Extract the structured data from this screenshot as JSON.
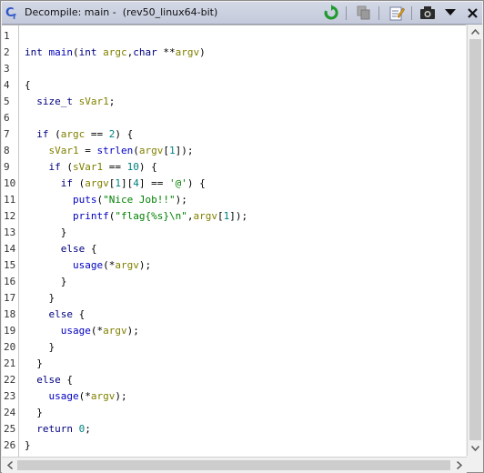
{
  "window": {
    "title": "Decompile: main - ",
    "subtitle": "(rev50_linux64-bit)"
  },
  "toolbar": {
    "icons": [
      "refresh-icon",
      "copy-icon",
      "edit-icon",
      "snapshot-icon",
      "dropdown-menu-icon",
      "close-icon"
    ]
  },
  "code_lines": [
    {
      "n": "1",
      "tokens": []
    },
    {
      "n": "2",
      "tokens": [
        {
          "t": "int main(int argc,char **argv)",
          "c": "kw-sig"
        }
      ]
    },
    {
      "n": "3",
      "tokens": []
    },
    {
      "n": "4",
      "tokens": [
        {
          "t": "{",
          "c": ""
        }
      ]
    },
    {
      "n": "5",
      "tokens": [
        {
          "t": "  ",
          "c": ""
        },
        {
          "t": "size_t",
          "c": "kw"
        },
        {
          "t": " ",
          "c": ""
        },
        {
          "t": "sVar1",
          "c": "var"
        },
        {
          "t": ";",
          "c": ""
        }
      ]
    },
    {
      "n": "6",
      "tokens": []
    },
    {
      "n": "7",
      "tokens": [
        {
          "t": "  ",
          "c": ""
        },
        {
          "t": "if",
          "c": "kw"
        },
        {
          "t": " (",
          "c": ""
        },
        {
          "t": "argc",
          "c": "var"
        },
        {
          "t": " == ",
          "c": ""
        },
        {
          "t": "2",
          "c": "num"
        },
        {
          "t": ") {",
          "c": ""
        }
      ]
    },
    {
      "n": "8",
      "tokens": [
        {
          "t": "    ",
          "c": ""
        },
        {
          "t": "sVar1",
          "c": "var"
        },
        {
          "t": " = ",
          "c": ""
        },
        {
          "t": "strlen",
          "c": "fn"
        },
        {
          "t": "(",
          "c": ""
        },
        {
          "t": "argv",
          "c": "var"
        },
        {
          "t": "[",
          "c": ""
        },
        {
          "t": "1",
          "c": "num"
        },
        {
          "t": "]);",
          "c": ""
        }
      ]
    },
    {
      "n": "9",
      "tokens": [
        {
          "t": "    ",
          "c": ""
        },
        {
          "t": "if",
          "c": "kw"
        },
        {
          "t": " (",
          "c": ""
        },
        {
          "t": "sVar1",
          "c": "var"
        },
        {
          "t": " == ",
          "c": ""
        },
        {
          "t": "10",
          "c": "num"
        },
        {
          "t": ") {",
          "c": ""
        }
      ]
    },
    {
      "n": "10",
      "tokens": [
        {
          "t": "      ",
          "c": ""
        },
        {
          "t": "if",
          "c": "kw"
        },
        {
          "t": " (",
          "c": ""
        },
        {
          "t": "argv",
          "c": "var"
        },
        {
          "t": "[",
          "c": ""
        },
        {
          "t": "1",
          "c": "num"
        },
        {
          "t": "][",
          "c": ""
        },
        {
          "t": "4",
          "c": "num"
        },
        {
          "t": "] == ",
          "c": ""
        },
        {
          "t": "'@'",
          "c": "str"
        },
        {
          "t": ") {",
          "c": ""
        }
      ]
    },
    {
      "n": "11",
      "tokens": [
        {
          "t": "        ",
          "c": ""
        },
        {
          "t": "puts",
          "c": "fn"
        },
        {
          "t": "(",
          "c": ""
        },
        {
          "t": "\"Nice Job!!\"",
          "c": "str"
        },
        {
          "t": ");",
          "c": ""
        }
      ]
    },
    {
      "n": "12",
      "tokens": [
        {
          "t": "        ",
          "c": ""
        },
        {
          "t": "printf",
          "c": "fn"
        },
        {
          "t": "(",
          "c": ""
        },
        {
          "t": "\"flag{%s}\\n\"",
          "c": "str"
        },
        {
          "t": ",",
          "c": ""
        },
        {
          "t": "argv",
          "c": "var"
        },
        {
          "t": "[",
          "c": ""
        },
        {
          "t": "1",
          "c": "num"
        },
        {
          "t": "]);",
          "c": ""
        }
      ]
    },
    {
      "n": "13",
      "tokens": [
        {
          "t": "      }",
          "c": ""
        }
      ]
    },
    {
      "n": "14",
      "tokens": [
        {
          "t": "      ",
          "c": ""
        },
        {
          "t": "else",
          "c": "kw"
        },
        {
          "t": " {",
          "c": ""
        }
      ]
    },
    {
      "n": "15",
      "tokens": [
        {
          "t": "        ",
          "c": ""
        },
        {
          "t": "usage",
          "c": "fn"
        },
        {
          "t": "(*",
          "c": ""
        },
        {
          "t": "argv",
          "c": "var"
        },
        {
          "t": ");",
          "c": ""
        }
      ]
    },
    {
      "n": "16",
      "tokens": [
        {
          "t": "      }",
          "c": ""
        }
      ]
    },
    {
      "n": "17",
      "tokens": [
        {
          "t": "    }",
          "c": ""
        }
      ]
    },
    {
      "n": "18",
      "tokens": [
        {
          "t": "    ",
          "c": ""
        },
        {
          "t": "else",
          "c": "kw"
        },
        {
          "t": " {",
          "c": ""
        }
      ]
    },
    {
      "n": "19",
      "tokens": [
        {
          "t": "      ",
          "c": ""
        },
        {
          "t": "usage",
          "c": "fn"
        },
        {
          "t": "(*",
          "c": ""
        },
        {
          "t": "argv",
          "c": "var"
        },
        {
          "t": ");",
          "c": ""
        }
      ]
    },
    {
      "n": "20",
      "tokens": [
        {
          "t": "    }",
          "c": ""
        }
      ]
    },
    {
      "n": "21",
      "tokens": [
        {
          "t": "  }",
          "c": ""
        }
      ]
    },
    {
      "n": "22",
      "tokens": [
        {
          "t": "  ",
          "c": ""
        },
        {
          "t": "else",
          "c": "kw"
        },
        {
          "t": " {",
          "c": ""
        }
      ]
    },
    {
      "n": "23",
      "tokens": [
        {
          "t": "    ",
          "c": ""
        },
        {
          "t": "usage",
          "c": "fn"
        },
        {
          "t": "(*",
          "c": ""
        },
        {
          "t": "argv",
          "c": "var"
        },
        {
          "t": ");",
          "c": ""
        }
      ]
    },
    {
      "n": "24",
      "tokens": [
        {
          "t": "  }",
          "c": ""
        }
      ]
    },
    {
      "n": "25",
      "tokens": [
        {
          "t": "  ",
          "c": ""
        },
        {
          "t": "return",
          "c": "kw"
        },
        {
          "t": " ",
          "c": ""
        },
        {
          "t": "0",
          "c": "num"
        },
        {
          "t": ";",
          "c": ""
        }
      ]
    },
    {
      "n": "26",
      "tokens": [
        {
          "t": "}",
          "c": ""
        }
      ]
    }
  ]
}
